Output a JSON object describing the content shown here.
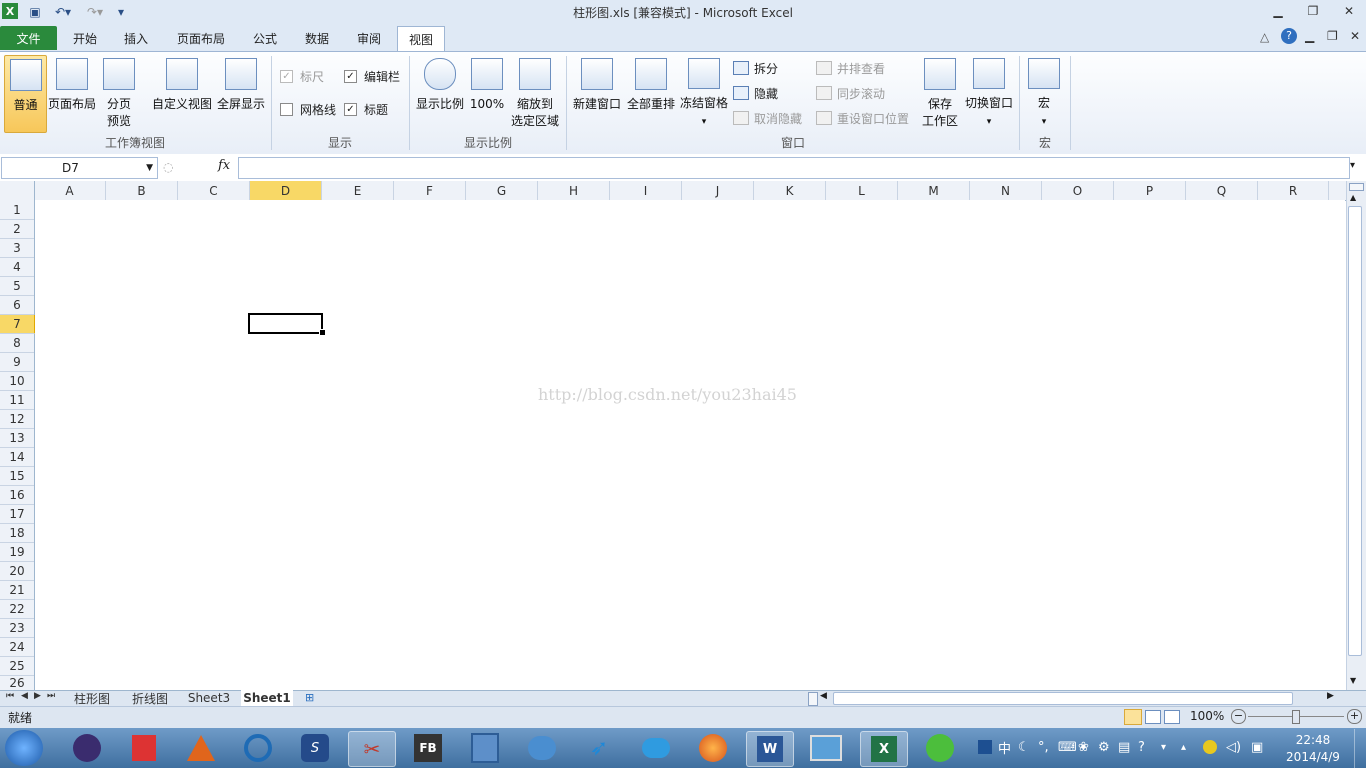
{
  "window": {
    "title": "柱形图.xls  [兼容模式] - Microsoft Excel"
  },
  "quick_access": {
    "save_icon": "save-icon",
    "undo_icon": "undo-icon",
    "redo_icon": "redo-icon"
  },
  "tabs": [
    "文件",
    "开始",
    "插入",
    "页面布局",
    "公式",
    "数据",
    "审阅",
    "视图"
  ],
  "ribbon": {
    "groups": [
      "工作簿视图",
      "显示",
      "显示比例",
      "窗口",
      "宏"
    ],
    "workbook_views": {
      "normal": "普通",
      "page_layout": "页面布局",
      "page_break_1": "分页",
      "page_break_2": "预览",
      "custom": "自定义视图",
      "fullscreen": "全屏显示"
    },
    "show": {
      "ruler": "标尺",
      "formula_bar": "编辑栏",
      "gridlines": "网格线",
      "headings": "标题"
    },
    "zoom": {
      "zoom": "显示比例",
      "zoom100": "100%",
      "zoom_sel_1": "缩放到",
      "zoom_sel_2": "选定区域"
    },
    "window_grp": {
      "new_window": "新建窗口",
      "arrange_all": "全部重排",
      "freeze": "冻结窗格",
      "split": "拆分",
      "hide": "隐藏",
      "unhide": "取消隐藏",
      "side_by_side": "并排查看",
      "sync_scroll": "同步滚动",
      "reset_pos": "重设窗口位置",
      "save_ws_1": "保存",
      "save_ws_2": "工作区",
      "switch": "切换窗口"
    },
    "macro": {
      "macros": "宏"
    }
  },
  "formula_bar": {
    "name_box": "D7",
    "fx": "fx",
    "value": ""
  },
  "grid": {
    "columns": [
      "A",
      "B",
      "C",
      "D",
      "E",
      "F",
      "G",
      "H",
      "I",
      "J",
      "K",
      "L",
      "M",
      "N",
      "O",
      "P",
      "Q",
      "R"
    ],
    "rows": [
      "1",
      "2",
      "3",
      "4",
      "5",
      "6",
      "7",
      "8",
      "9",
      "10",
      "11",
      "12",
      "13",
      "14",
      "15",
      "16",
      "17",
      "18",
      "19",
      "20",
      "21",
      "22",
      "23",
      "24",
      "25",
      "26"
    ],
    "selected_cell": "D7",
    "watermark": "http://blog.csdn.net/you23hai45"
  },
  "sheets": [
    "柱形图",
    "折线图",
    "Sheet3",
    "Sheet1"
  ],
  "status": {
    "ready": "就绪",
    "zoom": "100%"
  },
  "taskbar": {
    "clock_time": "22:48",
    "clock_date": "2014/4/9",
    "fb_label": "FB",
    "word_label": "W",
    "excel_label": "X",
    "ime_label": "中"
  },
  "colors": {
    "accent": "#2a8a3c",
    "selection": "#f8d866"
  }
}
